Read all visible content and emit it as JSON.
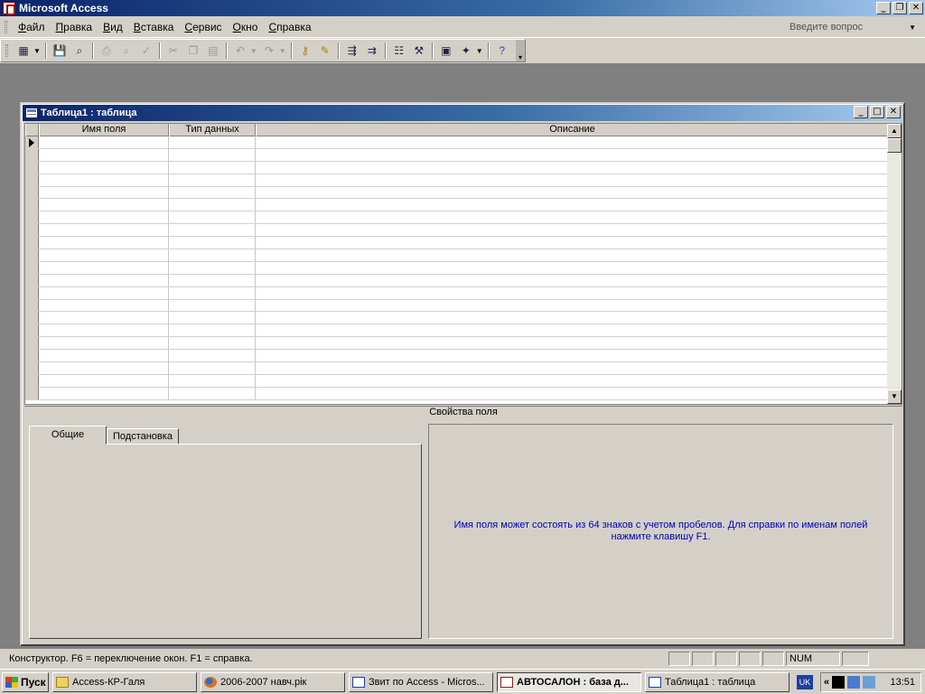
{
  "app": {
    "title": "Microsoft Access"
  },
  "menu": {
    "items": [
      "Файл",
      "Правка",
      "Вид",
      "Вставка",
      "Сервис",
      "Окно",
      "Справка"
    ],
    "ask_placeholder": "Введите вопрос"
  },
  "toolbar": {
    "buttons": [
      "view-icon",
      "save-icon",
      "search-icon",
      "print-icon",
      "print-preview-icon",
      "spelling-icon",
      "cut-icon",
      "copy-icon",
      "paste-icon",
      "undo-icon",
      "redo-icon",
      "primary-key-icon",
      "build-icon",
      "insert-rows-icon",
      "delete-rows-icon",
      "properties-icon",
      "build-wand-icon",
      "database-window-icon",
      "new-object-icon",
      "help-icon"
    ]
  },
  "table_window": {
    "title": "Таблица1 : таблица",
    "columns": [
      "Имя поля",
      "Тип данных",
      "Описание"
    ],
    "row_count": 21
  },
  "field_properties": {
    "caption": "Свойства поля",
    "tabs": [
      "Общие",
      "Подстановка"
    ],
    "help_text": "Имя поля может состоять из 64 знаков с учетом пробелов.  Для справки по именам полей нажмите клавишу F1."
  },
  "status": {
    "text": "Конструктор.  F6 = переключение окон.  F1 = справка.",
    "num": "NUM"
  },
  "taskbar": {
    "start": "Пуск",
    "tasks": [
      {
        "label": "Access-КР-Галя",
        "icon": "folder-icon",
        "active": false
      },
      {
        "label": "2006-2007 навч.рік",
        "icon": "firefox-icon",
        "active": false
      },
      {
        "label": "Звит по Access - Micros...",
        "icon": "word-icon",
        "active": false
      },
      {
        "label": "АВТОСАЛОН : база д...",
        "icon": "access-icon",
        "active": true
      },
      {
        "label": "Таблица1 : таблица",
        "icon": "table-icon",
        "active": false
      }
    ],
    "lang": "UK",
    "clock": "13:51"
  }
}
